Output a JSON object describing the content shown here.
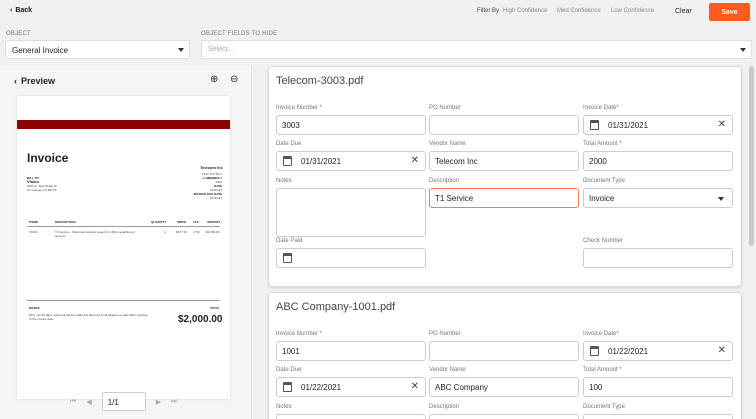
{
  "topbar": {
    "back": "Back",
    "filter_by": "Filter By",
    "filters": [
      "High Confidence",
      "Med Confidence",
      "Low Confidence"
    ],
    "clear": "Clear",
    "save": "Save"
  },
  "object": {
    "label": "OBJECT",
    "value": "General Invoice",
    "hide_label": "OBJECT FIELDS TO HIDE",
    "hide_placeholder": "Select..."
  },
  "preview": {
    "title": "Preview",
    "doc": {
      "company": "Telecom Inc",
      "address": [
        "1400 JFK Blvd",
        "Valley, CA"
      ],
      "title": "Invoice",
      "bill_to_label": "BILL TO:",
      "bill_to_name": "Vision",
      "bill_to_addr": [
        "4301 E. Tech Ridge Dr",
        "St. George, UT 84770"
      ],
      "right_labels": [
        "INVOICE #",
        "1001",
        "DATE",
        "01/01/21",
        "INVOICE DUE DATE",
        "01/31/21"
      ],
      "table_headers": [
        "ITEMS",
        "DESCRIPTION",
        "QUANTITY",
        "PRICE",
        "TAX",
        "AMOUNT"
      ],
      "row": [
        "T1001",
        "T1 Service - Data transmission speed of 1.544 megabits per second",
        "4",
        "$477.33",
        "4.7%",
        "$2,000.00"
      ],
      "notes_label": "NOTES:",
      "notes": "ETC, net 30 days, payment will be made 2% discount if full balance is paid within 10 days of the invoice date.",
      "total_label": "TOTAL",
      "total": "$2,000.00"
    },
    "page": "1/1"
  },
  "cards": [
    {
      "file": "Telecom-3003.pdf",
      "invoice_number_label": "Invoice Number *",
      "invoice_number": "3003",
      "po_number_label": "PO Number",
      "po_number": "",
      "invoice_date_label": "Invoice Date*",
      "invoice_date": "01/31/2021",
      "date_due_label": "Date Due",
      "date_due": "01/31/2021",
      "vendor_name_label": "Vendor Name",
      "vendor_name": "Telecom Inc",
      "total_amount_label": "Total Amount *",
      "total_amount": "2000",
      "notes_label": "Notes",
      "description_label": "Description",
      "description": "T1 Service",
      "document_type_label": "Document Type",
      "document_type": "Invoice",
      "date_paid_label": "Date Paid",
      "check_number_label": "Check Number"
    },
    {
      "file": "ABC Company-1001.pdf",
      "invoice_number_label": "Invoice Number *",
      "invoice_number": "1001",
      "po_number_label": "PO Number",
      "invoice_date_label": "Invoice Date*",
      "invoice_date": "01/22/2021",
      "date_due_label": "Date Due",
      "date_due": "01/22/2021",
      "vendor_name_label": "Vendor Name",
      "vendor_name": "ABC Company",
      "total_amount_label": "Total Amount *",
      "total_amount": "100",
      "notes_label": "Notes",
      "description_label": "Description",
      "document_type_label": "Document Type"
    }
  ],
  "colors": {
    "accent": "#ff5a1f",
    "focus_border": "#ff7a45",
    "doc_band": "#8b0000"
  }
}
